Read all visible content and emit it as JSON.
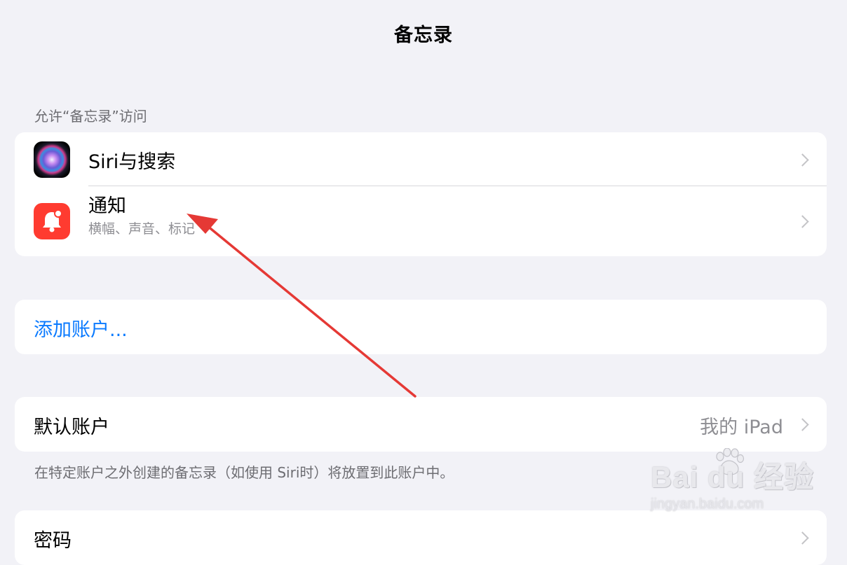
{
  "header": {
    "title": "备忘录"
  },
  "access_section": {
    "header": "允许“备忘录”访问",
    "items": [
      {
        "label": "Siri与搜索",
        "icon": "siri-icon"
      },
      {
        "label": "通知",
        "subtitle": "横幅、声音、标记",
        "icon": "bell-icon"
      }
    ]
  },
  "accounts": {
    "add_account_label": "添加账户..."
  },
  "default_account": {
    "label": "默认账户",
    "value": "我的 iPad",
    "footnote": "在特定账户之外创建的备忘录（如使用 Siri时）将放置到此账户中。"
  },
  "password": {
    "label": "密码"
  },
  "watermark": {
    "brand": "Bai du 经验",
    "url": "jingyan.baidu.com"
  },
  "colors": {
    "accent": "#0a7aff",
    "notif_icon": "#ff3b30",
    "arrow": "#e53935"
  }
}
